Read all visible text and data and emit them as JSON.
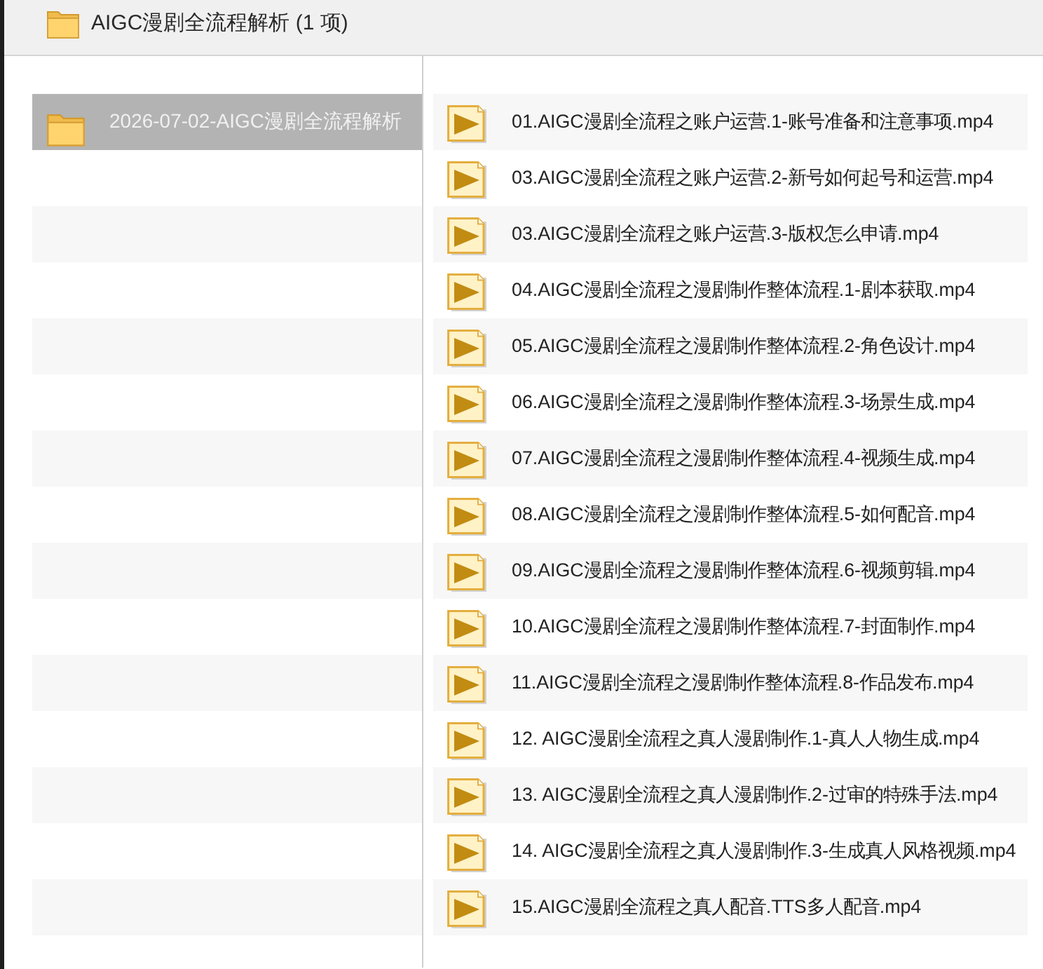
{
  "header": {
    "title": "AIGC漫剧全流程解析 (1 项)"
  },
  "folders": [
    {
      "name": "2026-07-02-AIGC漫剧全流程解析",
      "selected": true
    }
  ],
  "files": [
    {
      "name": "01.AIGC漫剧全流程之账户运营.1-账号准备和注意事项.mp4",
      "selected": false
    },
    {
      "name": "03.AIGC漫剧全流程之账户运营.2-新号如何起号和运营.mp4",
      "selected": false
    },
    {
      "name": "03.AIGC漫剧全流程之账户运营.3-版权怎么申请.mp4",
      "selected": false
    },
    {
      "name": "04.AIGC漫剧全流程之漫剧制作整体流程.1-剧本获取.mp4",
      "selected": false
    },
    {
      "name": "05.AIGC漫剧全流程之漫剧制作整体流程.2-角色设计.mp4",
      "selected": false
    },
    {
      "name": "06.AIGC漫剧全流程之漫剧制作整体流程.3-场景生成.mp4",
      "selected": false
    },
    {
      "name": "07.AIGC漫剧全流程之漫剧制作整体流程.4-视频生成.mp4",
      "selected": false
    },
    {
      "name": "08.AIGC漫剧全流程之漫剧制作整体流程.5-如何配音.mp4",
      "selected": false
    },
    {
      "name": "09.AIGC漫剧全流程之漫剧制作整体流程.6-视频剪辑.mp4",
      "selected": false
    },
    {
      "name": "10.AIGC漫剧全流程之漫剧制作整体流程.7-封面制作.mp4",
      "selected": false
    },
    {
      "name": "11.AIGC漫剧全流程之漫剧制作整体流程.8-作品发布.mp4",
      "selected": false
    },
    {
      "name": "12. AIGC漫剧全流程之真人漫剧制作.1-真人人物生成.mp4",
      "selected": false
    },
    {
      "name": "13. AIGC漫剧全流程之真人漫剧制作.2-过审的特殊手法.mp4",
      "selected": false
    },
    {
      "name": "14. AIGC漫剧全流程之真人漫剧制作.3-生成真人风格视频.mp4",
      "selected": false
    },
    {
      "name": "15.AIGC漫剧全流程之真人配音.TTS多人配音.mp4",
      "selected": false
    }
  ]
}
